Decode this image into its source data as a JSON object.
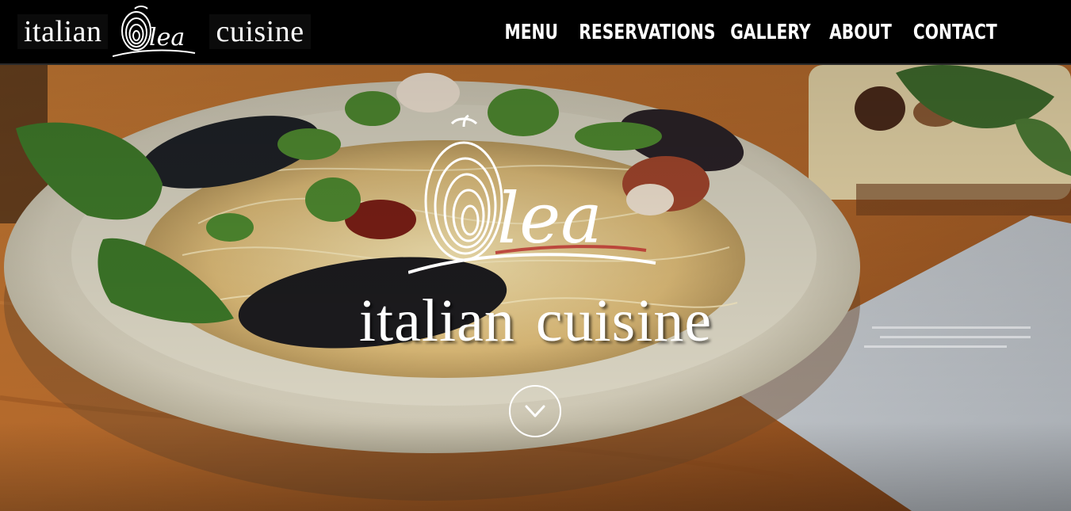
{
  "brand": {
    "word_left": "italian",
    "logo_text": "lea",
    "word_right": "cuisine"
  },
  "nav": {
    "items": [
      "MENU",
      "RESERVATIONS",
      "GALLERY",
      "ABOUT",
      "CONTACT"
    ]
  },
  "hero": {
    "logo_text": "lea",
    "tagline": "italian cuisine",
    "scroll_icon": "chevron-down-icon"
  },
  "colors": {
    "nav_bg": "#000000",
    "text": "#ffffff",
    "wood": "#b86a2c",
    "bowl": "#d8d4c4"
  }
}
